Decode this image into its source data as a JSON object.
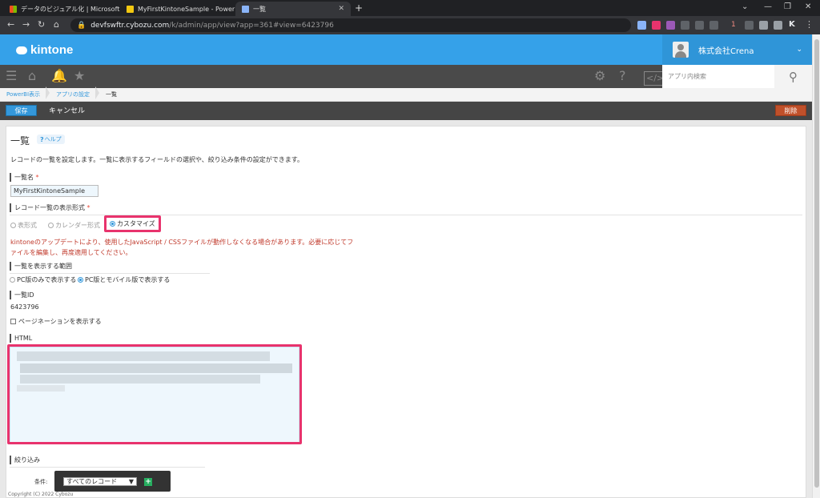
{
  "browser": {
    "tabs": [
      {
        "title": "データのビジュアル化 | Microsoft Po",
        "icon": "microsoft-icon"
      },
      {
        "title": "MyFirstKintoneSample - Power BI",
        "icon": "powerbi-icon"
      },
      {
        "title": "一覧",
        "icon": "kintone-icon",
        "active": true
      }
    ],
    "url_host": "devfswftr.cybozu.com",
    "url_path": "/k/admin/app/view?app=361#view=6423796",
    "ext_badge": "1",
    "profile": "K"
  },
  "header": {
    "logo": "kintone",
    "company": "株式会社Crena",
    "search_placeholder": "アプリ内検索"
  },
  "breadcrumb": [
    "PowerBI表示",
    "アプリの設定",
    "一覧"
  ],
  "actions": {
    "save": "保存",
    "cancel": "キャンセル",
    "delete": "削除"
  },
  "page": {
    "title": "一覧",
    "help": "ヘルプ",
    "description": "レコードの一覧を設定します。一覧に表示するフィールドの選択や、絞り込み条件の設定ができます。",
    "view_name_label": "一覧名",
    "view_name_value": "MyFirstKintoneSample",
    "format_label": "レコード一覧の表示形式",
    "format_options": [
      "表形式",
      "カレンダー形式",
      "カスタマイズ"
    ],
    "warning": "kintoneのアップデートにより、使用したJavaScript / CSSファイルが動作しなくなる場合があります。必要に応じてファイルを編集し、再度適用してください。",
    "scope_label": "一覧を表示する範囲",
    "scope_options": [
      "PC版のみで表示する",
      "PC版とモバイル版で表示する"
    ],
    "id_label": "一覧ID",
    "id_value": "6423796",
    "pagination": "ページネーションを表示する",
    "html_label": "HTML",
    "filter_label": "絞り込み",
    "condition_label": "条件:",
    "condition_value": "すべてのレコード"
  },
  "footer": "Copyright (C) 2022 Cybozu",
  "colors": {
    "header_blue": "#35a1e9",
    "highlight": "#e8336d",
    "save": "#3498db",
    "delete": "#c0502a"
  }
}
